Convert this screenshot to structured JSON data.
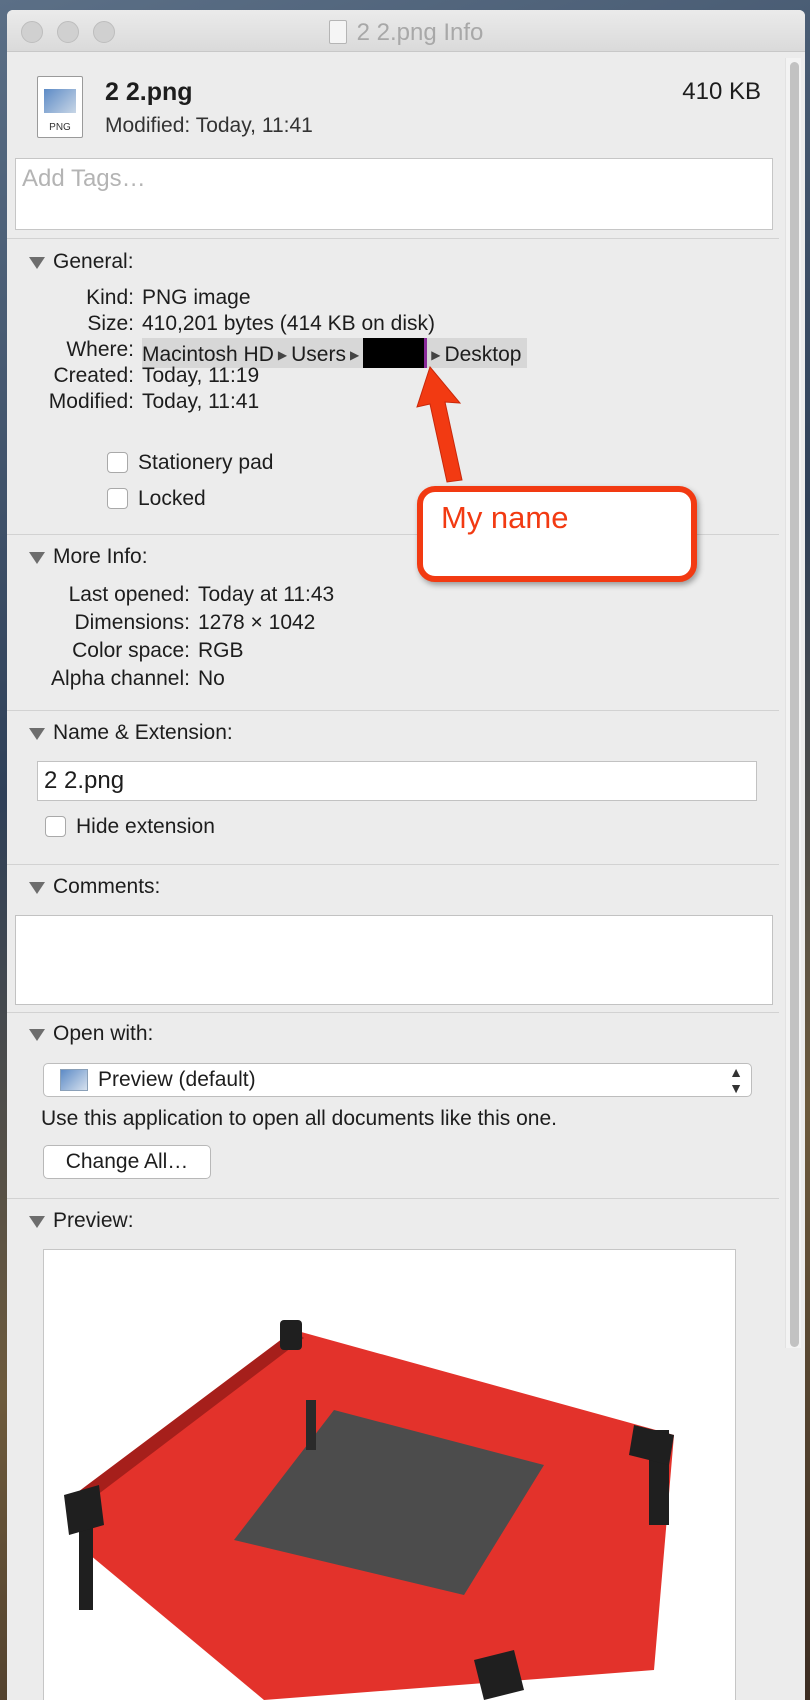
{
  "window": {
    "title": "2 2.png Info"
  },
  "header": {
    "file_name": "2 2.png",
    "file_size": "410 KB",
    "modified_label": "Modified:",
    "modified_value": "Today, 11:41",
    "icon_ext": "PNG"
  },
  "tags": {
    "placeholder": "Add Tags…"
  },
  "general": {
    "heading": "General:",
    "kind": {
      "label": "Kind:",
      "value": "PNG image"
    },
    "size": {
      "label": "Size:",
      "value": "410,201 bytes (414 KB on disk)"
    },
    "where": {
      "label": "Where:",
      "segments": [
        "Macintosh HD",
        "Users",
        "Desktop"
      ]
    },
    "created": {
      "label": "Created:",
      "value": "Today, 11:19"
    },
    "modified": {
      "label": "Modified:",
      "value": "Today, 11:41"
    },
    "stationery": "Stationery pad",
    "locked": "Locked"
  },
  "annotation": {
    "text": "My name",
    "color": "#f23a12"
  },
  "more_info": {
    "heading": "More Info:",
    "last_opened": {
      "label": "Last opened:",
      "value": "Today at 11:43"
    },
    "dimensions": {
      "label": "Dimensions:",
      "value": "1278 × 1042"
    },
    "color_space": {
      "label": "Color space:",
      "value": "RGB"
    },
    "alpha": {
      "label": "Alpha channel:",
      "value": "No"
    }
  },
  "name_ext": {
    "heading": "Name & Extension:",
    "value": "2 2.png",
    "hide_extension": "Hide extension"
  },
  "comments": {
    "heading": "Comments:",
    "value": ""
  },
  "open_with": {
    "heading": "Open with:",
    "app": "Preview (default)",
    "note": "Use this application to open all documents like this one.",
    "change_all": "Change All…"
  },
  "preview": {
    "heading": "Preview:",
    "subject_color": "#e3322b"
  }
}
